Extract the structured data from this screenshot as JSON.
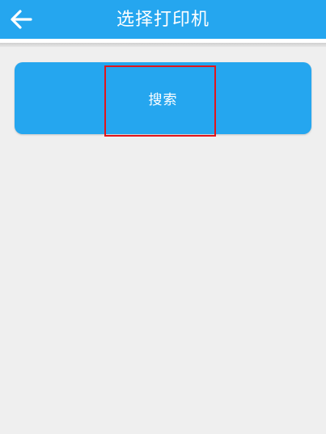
{
  "header": {
    "title": "选择打印机",
    "back_icon": "arrow-left-icon"
  },
  "main": {
    "search_button_label": "搜索"
  },
  "colors": {
    "primary": "#25a6ef",
    "background": "#efefef",
    "highlight": "#e0161c",
    "text_on_primary": "#ffffff"
  }
}
